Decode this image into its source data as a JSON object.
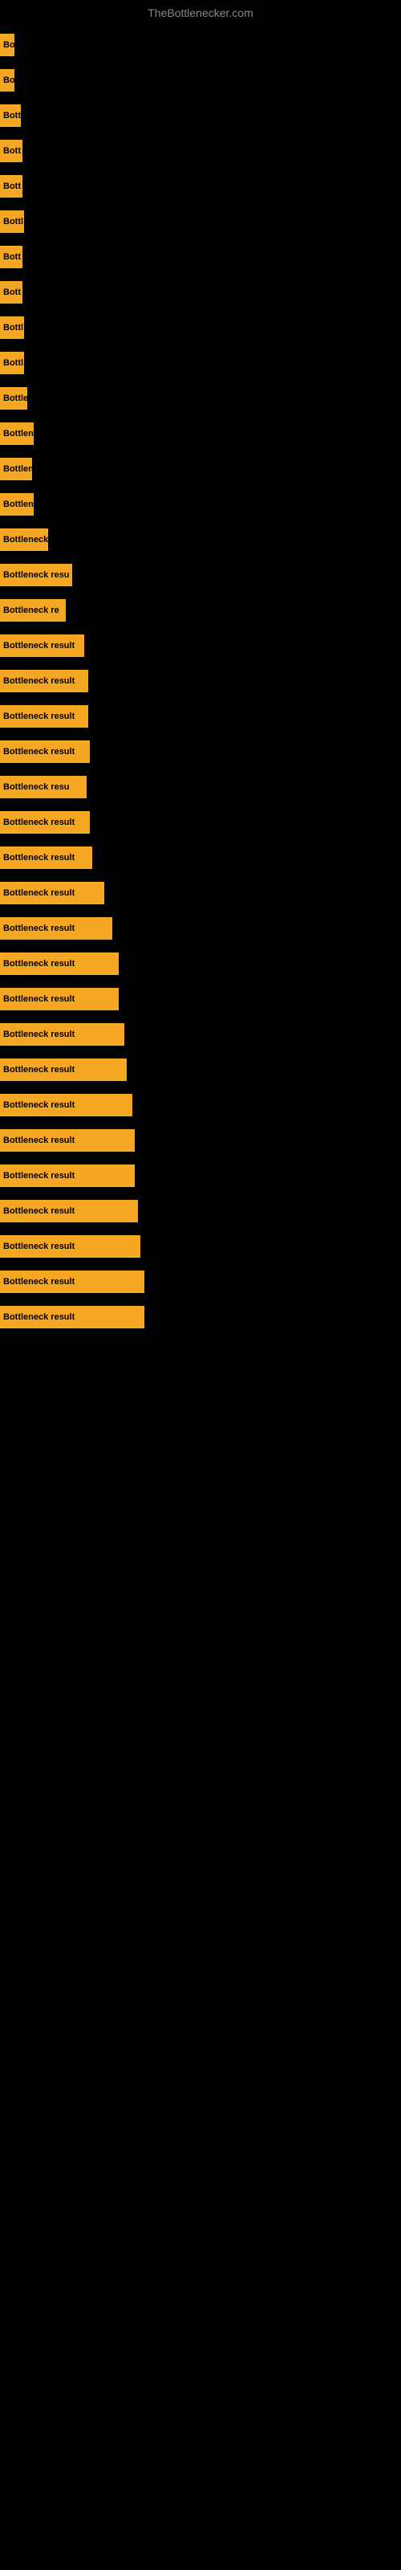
{
  "site": {
    "title": "TheBottlenecker.com"
  },
  "bars": [
    {
      "label": "Bo",
      "width": 18
    },
    {
      "label": "Bo",
      "width": 18
    },
    {
      "label": "Bott",
      "width": 26
    },
    {
      "label": "Bott",
      "width": 28
    },
    {
      "label": "Bott",
      "width": 28
    },
    {
      "label": "Bottl",
      "width": 30
    },
    {
      "label": "Bott",
      "width": 28
    },
    {
      "label": "Bott",
      "width": 28
    },
    {
      "label": "Bottl",
      "width": 30
    },
    {
      "label": "Bottl",
      "width": 30
    },
    {
      "label": "Bottle",
      "width": 34
    },
    {
      "label": "Bottlen",
      "width": 42
    },
    {
      "label": "Bottlen",
      "width": 40
    },
    {
      "label": "Bottlen",
      "width": 42
    },
    {
      "label": "Bottleneck",
      "width": 60
    },
    {
      "label": "Bottleneck resu",
      "width": 90
    },
    {
      "label": "Bottleneck re",
      "width": 82
    },
    {
      "label": "Bottleneck result",
      "width": 105
    },
    {
      "label": "Bottleneck result",
      "width": 110
    },
    {
      "label": "Bottleneck result",
      "width": 110
    },
    {
      "label": "Bottleneck result",
      "width": 112
    },
    {
      "label": "Bottleneck resu",
      "width": 108
    },
    {
      "label": "Bottleneck result",
      "width": 112
    },
    {
      "label": "Bottleneck result",
      "width": 115
    },
    {
      "label": "Bottleneck result",
      "width": 130
    },
    {
      "label": "Bottleneck result",
      "width": 140
    },
    {
      "label": "Bottleneck result",
      "width": 148
    },
    {
      "label": "Bottleneck result",
      "width": 148
    },
    {
      "label": "Bottleneck result",
      "width": 155
    },
    {
      "label": "Bottleneck result",
      "width": 158
    },
    {
      "label": "Bottleneck result",
      "width": 165
    },
    {
      "label": "Bottleneck result",
      "width": 168
    },
    {
      "label": "Bottleneck result",
      "width": 168
    },
    {
      "label": "Bottleneck result",
      "width": 172
    },
    {
      "label": "Bottleneck result",
      "width": 175
    },
    {
      "label": "Bottleneck result",
      "width": 180
    },
    {
      "label": "Bottleneck result",
      "width": 180
    }
  ]
}
